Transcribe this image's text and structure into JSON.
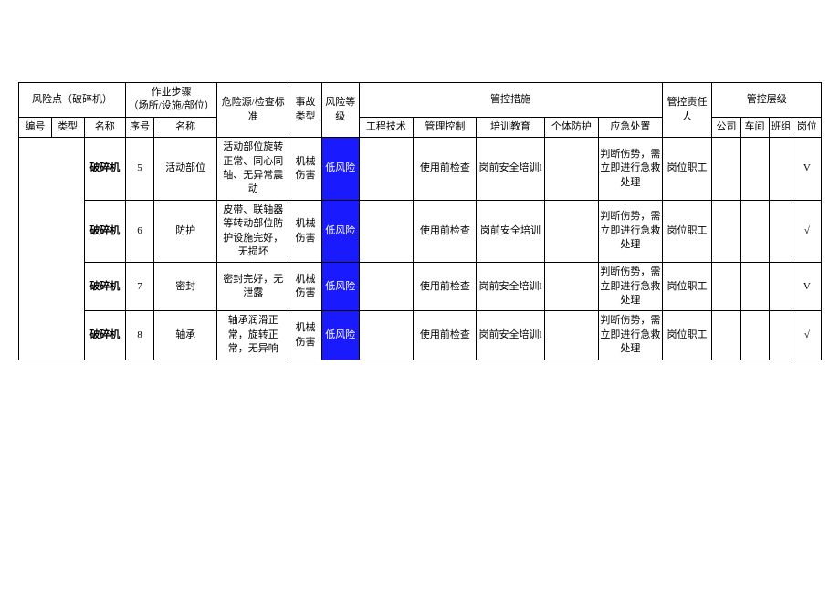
{
  "headers": {
    "risk_point": "风险点（破碎机）",
    "work_step": "作业步骤\n（场所/设施/部位）",
    "hazard": "危险源/检查标准",
    "accident": "事故类型",
    "risk_level": "风险等级",
    "control_measures": "管控措施",
    "responsible": "管控责任人",
    "control_level": "管控层级",
    "id": "编号",
    "type": "类型",
    "name": "名称",
    "seq": "序号",
    "step_name": "名称",
    "engineering": "工程技术",
    "management": "管理控制",
    "training": "培训教育",
    "ppe": "个体防护",
    "emergency": "应急处置",
    "company": "公司",
    "workshop": "车间",
    "team": "班组",
    "post": "岗位"
  },
  "chart_data": {
    "type": "table",
    "rows": [
      {
        "name": "破碎机",
        "seq": "5",
        "step": "活动部位",
        "hazard": "活动部位旋转正常、同心同轴、无异常震动",
        "accident": "机械伤害",
        "level": "低风险",
        "engineering": "",
        "management": "使用前检查",
        "training": "岗前安全培训l",
        "ppe": "",
        "emergency": "判断伤势，需立即进行急救处理",
        "responsible": "岗位职工",
        "company": "",
        "workshop": "",
        "team": "",
        "post": "V"
      },
      {
        "name": "破碎机",
        "seq": "6",
        "step": "防护",
        "hazard": "皮带、联轴器等转动部位防护设施完好，无损坏",
        "accident": "机械伤害",
        "level": "低风险",
        "engineering": "",
        "management": "使用前检查",
        "training": "岗前安全培训",
        "ppe": "",
        "emergency": "判断伤势，需立即进行急救处理",
        "responsible": "岗位职工",
        "company": "",
        "workshop": "",
        "team": "",
        "post": "√"
      },
      {
        "name": "破碎机",
        "seq": "7",
        "step": "密封",
        "hazard": "密封完好，无泄露",
        "accident": "机械伤害",
        "level": "低风险",
        "engineering": "",
        "management": "使用前检查",
        "training": "岗前安全培训l",
        "ppe": "",
        "emergency": "判断伤势，需立即进行急救处理",
        "responsible": "岗位职工",
        "company": "",
        "workshop": "",
        "team": "",
        "post": "V"
      },
      {
        "name": "破碎机",
        "seq": "8",
        "step": "轴承",
        "hazard": "轴承润滑正常，旋转正常，无异响",
        "accident": "机械伤害",
        "level": "低风险",
        "engineering": "",
        "management": "使用前检查",
        "training": "岗前安全培训l",
        "ppe": "",
        "emergency": "判断伤势，需立即进行急救处理",
        "responsible": "岗位职工",
        "company": "",
        "workshop": "",
        "team": "",
        "post": "√"
      }
    ]
  }
}
